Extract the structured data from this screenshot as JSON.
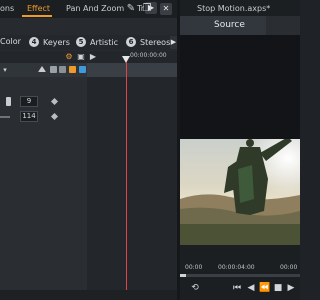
{
  "tabs": [
    {
      "label": "ons",
      "active": false
    },
    {
      "label": "Effect",
      "active": true
    },
    {
      "label": "Pan And Zoom",
      "active": false
    },
    {
      "label": "Tr",
      "active": false
    }
  ],
  "categories": [
    {
      "num": "",
      "label": "Color"
    },
    {
      "num": "4",
      "label": "Keyers"
    },
    {
      "num": "5",
      "label": "Artistic"
    },
    {
      "num": "6",
      "label": "Stereos"
    }
  ],
  "timeline": {
    "ruler_start": "00:00:00:00"
  },
  "params": [
    {
      "value": "9"
    },
    {
      "value": "114"
    }
  ],
  "preview": {
    "window_title": "Stop Motion.axps*",
    "source_tab": "Source",
    "ruler_labels": [
      "00:00",
      "00:00:04:00",
      "00:00"
    ]
  },
  "colors": {
    "accent": "#f09a2a",
    "playhead": "#e04444"
  },
  "icons": {
    "wrench": "wrench-icon",
    "copy": "copy-icon",
    "play": "play-icon",
    "next": "next-arrow-icon"
  }
}
